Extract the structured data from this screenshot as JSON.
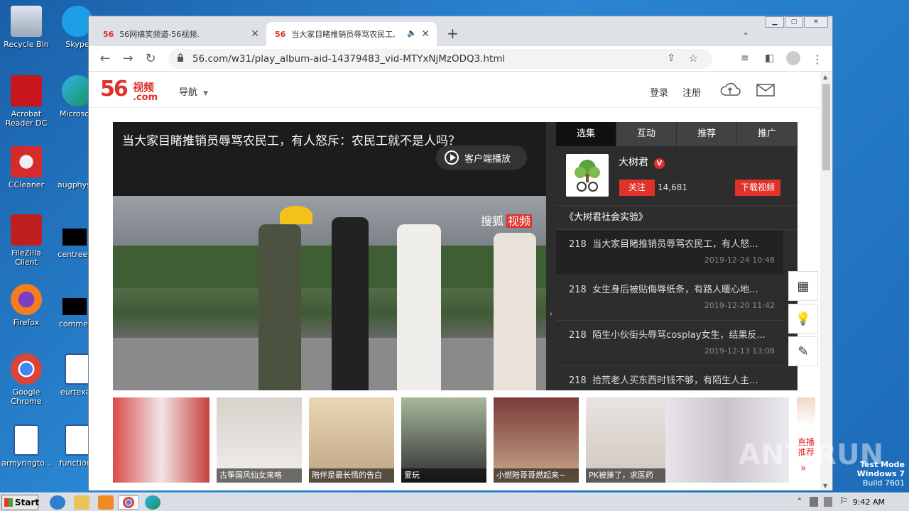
{
  "desktop": {
    "icons": [
      {
        "label": "Recycle Bin",
        "name": "recycle-bin"
      },
      {
        "label": "Skype",
        "name": "skype"
      },
      {
        "label": "Acrobat Reader DC",
        "name": "acrobat"
      },
      {
        "label": "Microsoft",
        "name": "edge"
      },
      {
        "label": "CCleaner",
        "name": "ccleaner"
      },
      {
        "label": "augphysic",
        "name": "augphysic"
      },
      {
        "label": "FileZilla Client",
        "name": "filezilla"
      },
      {
        "label": "centreeve",
        "name": "centreeve"
      },
      {
        "label": "Firefox",
        "name": "firefox"
      },
      {
        "label": "comment",
        "name": "comment"
      },
      {
        "label": "Google Chrome",
        "name": "chrome"
      },
      {
        "label": "eurtexas",
        "name": "eurtexas"
      },
      {
        "label": "armyringto...",
        "name": "armyringto"
      },
      {
        "label": "functions",
        "name": "functions"
      }
    ],
    "watermark": "ANY RUN",
    "testmode": [
      "Test Mode",
      "Windows 7",
      "Build 7601"
    ]
  },
  "browser": {
    "tabs": [
      {
        "favicon": "56",
        "title": "56网搞笑频道-56视频."
      },
      {
        "favicon": "56",
        "title": "当大家目睹推销员辱骂农民工,"
      }
    ],
    "new_tab": "+",
    "url": "56.com/w31/play_album-aid-14379483_vid-MTYxNjMzODQ3.html"
  },
  "site": {
    "logo_num": "56",
    "logo_cn": "视频",
    "logo_com": ".com",
    "nav_label": "导航",
    "login": "登录",
    "register": "注册"
  },
  "player": {
    "title": "当大家目睹推销员辱骂农民工，有人怒斥：农民工就不是人吗？",
    "client_play": "客户端播放",
    "watermark_a": "搜狐",
    "watermark_b": "视频"
  },
  "side": {
    "tabs": [
      "选集",
      "互动",
      "推荐",
      "推广"
    ],
    "author_name": "大树君",
    "verified": "V",
    "follow": "关注",
    "followers": "14,681",
    "download": "下载视频",
    "album": "《大树君社会实验》",
    "episodes": [
      {
        "num": "218",
        "title": "当大家目睹推销员辱骂农民工，有人怒...",
        "date": "2019-12-24 10:48"
      },
      {
        "num": "218",
        "title": "女生身后被贴侮辱纸条，有路人暖心地...",
        "date": "2019-12-20 11:42"
      },
      {
        "num": "218",
        "title": "陌生小伙街头辱骂cosplay女生，结果反...",
        "date": "2019-12-13 13:08"
      },
      {
        "num": "218",
        "title": "拾荒老人买东西时钱不够，有陌生人主...",
        "date": ""
      }
    ]
  },
  "strip": {
    "items": [
      {
        "caption": ""
      },
      {
        "caption": "古筝国风仙女来咯"
      },
      {
        "caption": "陪伴是最长情的告白"
      },
      {
        "caption": "爱玩"
      },
      {
        "caption": "小燃陪哥哥燃起来~"
      },
      {
        "caption": "PK被揍了，求医药"
      },
      {
        "caption": ""
      }
    ],
    "rec_label": "直播推荐"
  },
  "taskbar": {
    "start": "Start",
    "clock": "9:42 AM"
  }
}
